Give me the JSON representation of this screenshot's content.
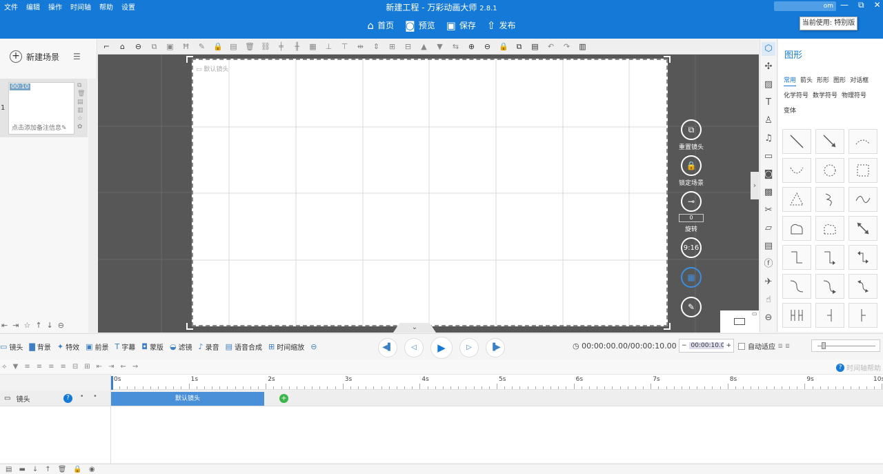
{
  "menus": [
    "文件",
    "编辑",
    "操作",
    "时间轴",
    "帮助",
    "设置"
  ],
  "app": {
    "title": "新建工程 - 万彩动画大师",
    "version": "2.8.1"
  },
  "account": "om",
  "tooltip": "当前使用: 特别版",
  "nav": {
    "home": "首页",
    "preview": "预览",
    "save": "保存",
    "publish": "发布"
  },
  "left": {
    "new_scene": "新建场景",
    "scene_number": "1",
    "scene_time": "00:10",
    "scene_note": "点击添加备注信息"
  },
  "stage": {
    "lens_label": "默认镜头",
    "rotate_value": "0",
    "ratio": "9:16"
  },
  "controls": {
    "reset_lens": "重置镜头",
    "lock_scene": "锁定场景",
    "rotate": "旋转"
  },
  "right": {
    "title": "图形",
    "tabs": [
      "常用",
      "箭头",
      "形形",
      "图形",
      "对话框",
      "化学符号",
      "数学符号",
      "物理符号",
      "变体"
    ]
  },
  "tools": [
    "镜头",
    "背景",
    "特效",
    "前景",
    "字幕",
    "蒙版",
    "滤镜",
    "录音",
    "语音合成",
    "时间缩放"
  ],
  "timecode": "00:00:00.00/00:00:10.00",
  "duration": "00:00:10.0",
  "autofit": "自动适应",
  "timeline": {
    "help": "时间轴帮助",
    "track_name": "镜头",
    "clip_label": "默认镜头",
    "ruler": [
      "0s",
      "1s",
      "2s",
      "3s",
      "4s",
      "5s",
      "6s",
      "7s",
      "8s",
      "9s",
      "10s"
    ]
  }
}
